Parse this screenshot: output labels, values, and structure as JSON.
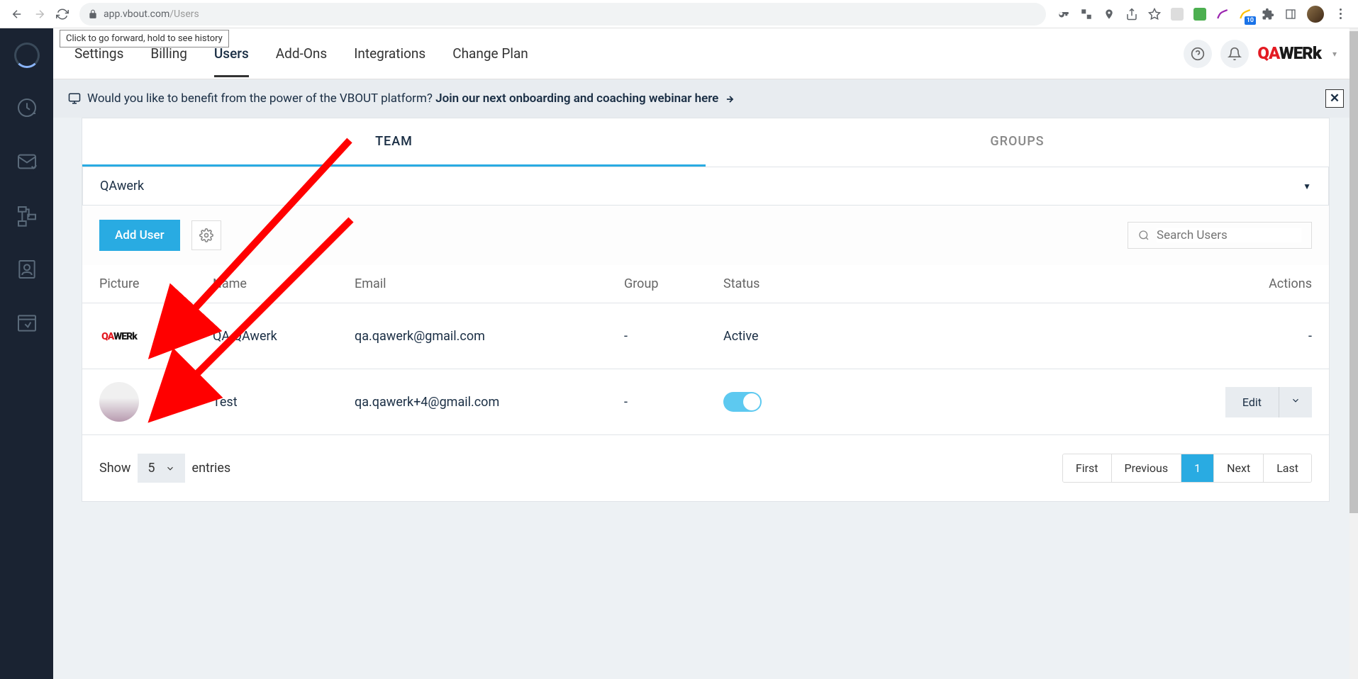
{
  "browser": {
    "url_host": "app.vbout.com",
    "url_path": "/Users",
    "badge": "10",
    "tooltip": "Click to go forward, hold to see history"
  },
  "header": {
    "nav": [
      "Settings",
      "Billing",
      "Users",
      "Add-Ons",
      "Integrations",
      "Change Plan"
    ],
    "active_index": 2
  },
  "banner": {
    "prefix": "Would you like to benefit from the power of the VBOUT platform? ",
    "link": "Join our next onboarding and coaching webinar here"
  },
  "tabs": {
    "items": [
      "TEAM",
      "GROUPS"
    ],
    "active_index": 0
  },
  "dropdown": {
    "label": "QAwerk"
  },
  "toolbar": {
    "add_user": "Add User",
    "search_placeholder": "Search Users"
  },
  "table": {
    "headers": {
      "picture": "Picture",
      "name": "Name",
      "email": "Email",
      "group": "Group",
      "status": "Status",
      "actions": "Actions"
    },
    "rows": [
      {
        "name": "QA QAwerk",
        "email": "qa.qawerk@gmail.com",
        "group": "-",
        "status": "Active",
        "actions": "-"
      },
      {
        "name": "Test",
        "email": "qa.qawerk+4@gmail.com",
        "group": "-",
        "status_toggle": true,
        "actions_edit": "Edit"
      }
    ]
  },
  "footer": {
    "show": "Show",
    "entries_count": "5",
    "entries": "entries",
    "pagination": [
      "First",
      "Previous",
      "1",
      "Next",
      "Last"
    ],
    "active_page_index": 2
  }
}
